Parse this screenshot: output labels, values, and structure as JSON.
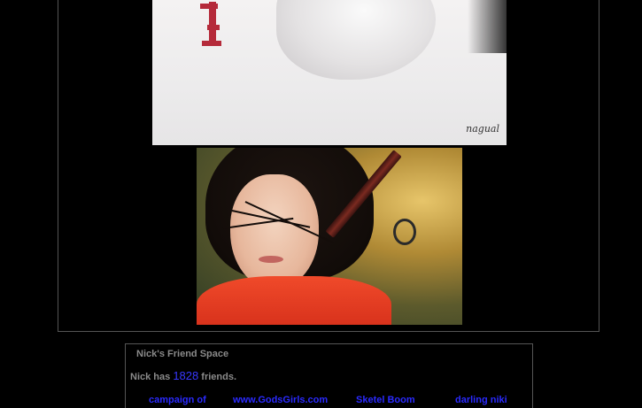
{
  "friend_space": {
    "title": "Nick's Friend Space",
    "count_prefix": "Nick has",
    "count": "1828",
    "count_suffix": "friends."
  },
  "friends": [
    {
      "name": "campaign of"
    },
    {
      "name": "www.GodsGirls.com"
    },
    {
      "name": "Sketel Boom"
    },
    {
      "name": "darling niki"
    }
  ],
  "colors": {
    "background": "#000000",
    "border": "#555555",
    "heading_text": "#8a8a8a",
    "link": "#2a2aff",
    "count": "#3838ff"
  }
}
